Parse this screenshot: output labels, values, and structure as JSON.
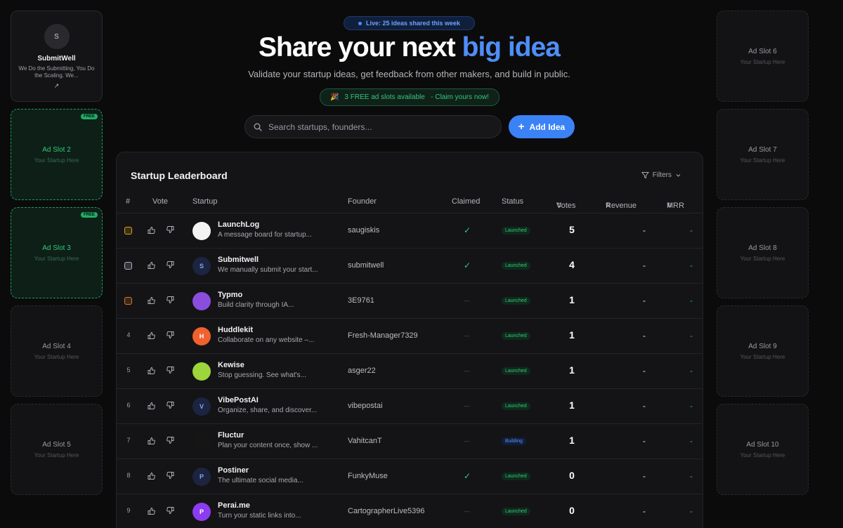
{
  "sponsor": {
    "avatar_letter": "S",
    "name": "SubmitWell",
    "tagline": "We Do the Submitting, You Do the Scaling. We...",
    "link_glyph": "↗"
  },
  "ad_slots_left": [
    {
      "title": "Ad Slot 2",
      "subtitle": "Your Startup Here",
      "badge": "FREE",
      "free": true
    },
    {
      "title": "Ad Slot 3",
      "subtitle": "Your Startup Here",
      "badge": "FREE",
      "free": true
    },
    {
      "title": "Ad Slot 4",
      "subtitle": "Your Startup Here",
      "free": false
    },
    {
      "title": "Ad Slot 5",
      "subtitle": "Your Startup Here",
      "free": false
    }
  ],
  "ad_slots_right": [
    {
      "title": "Ad Slot 6",
      "subtitle": "Your Startup Here"
    },
    {
      "title": "Ad Slot 7",
      "subtitle": "Your Startup Here"
    },
    {
      "title": "Ad Slot 8",
      "subtitle": "Your Startup Here"
    },
    {
      "title": "Ad Slot 9",
      "subtitle": "Your Startup Here"
    },
    {
      "title": "Ad Slot 10",
      "subtitle": "Your Startup Here"
    }
  ],
  "hero": {
    "live_badge": "Live: 25 ideas shared this week",
    "headline_main": "Share your next ",
    "headline_accent": "big idea",
    "subheadline": "Validate your startup ideas, get feedback from other makers, and build in public.",
    "claim_banner": "3 FREE ad slots available   - Claim yours now!",
    "claim_icon": "🎉"
  },
  "search": {
    "placeholder": "Search startups, founders..."
  },
  "add_button": {
    "label": "Add Idea",
    "icon": "+"
  },
  "leaderboard": {
    "title": "Startup Leaderboard",
    "filters_label": "Filters",
    "columns": {
      "rank": "#",
      "vote": "Vote",
      "startup": "Startup",
      "founder": "Founder",
      "claimed": "Claimed",
      "status": "Status",
      "votes": "Votes",
      "revenue": "Revenue",
      "mrr": "MRR"
    },
    "rows": [
      {
        "rank": "1",
        "medal": "#d9a21b",
        "name": "LaunchLog",
        "desc": "A message board for startup...",
        "founder": "saugiskis",
        "claimed": true,
        "status": "Launched",
        "votes": "5",
        "revenue": "-",
        "mrr": "-",
        "logo_letter": "",
        "logo_bg": "#f3f3f3"
      },
      {
        "rank": "2",
        "medal": "#a9b3c2",
        "name": "Submitwell",
        "desc": "We manually submit your start...",
        "founder": "submitwell",
        "claimed": true,
        "status": "Launched",
        "votes": "4",
        "revenue": "-",
        "mrr": "-",
        "logo_letter": "S",
        "logo_bg": "#1c2440"
      },
      {
        "rank": "3",
        "medal": "#d9772a",
        "name": "Typmo",
        "desc": "Build clarity through IA...",
        "founder": "3E9761",
        "claimed": false,
        "status": "Launched",
        "votes": "1",
        "revenue": "-",
        "mrr": "-",
        "logo_letter": "",
        "logo_bg": "#8b4dde"
      },
      {
        "rank": "4",
        "name": "Huddlekit",
        "desc": "Collaborate on any website –...",
        "founder": "Fresh-Manager7329",
        "claimed": false,
        "status": "Launched",
        "votes": "1",
        "revenue": "-",
        "mrr": "-",
        "logo_letter": "H",
        "logo_bg": "#f0612e"
      },
      {
        "rank": "5",
        "name": "Kewise",
        "desc": "Stop guessing. See what's...",
        "founder": "asger22",
        "claimed": false,
        "status": "Launched",
        "votes": "1",
        "revenue": "-",
        "mrr": "-",
        "logo_letter": "",
        "logo_bg": "#9cd63a"
      },
      {
        "rank": "6",
        "name": "VibePostAI",
        "desc": "Organize, share, and discover...",
        "founder": "vibepostai",
        "claimed": false,
        "status": "Launched",
        "votes": "1",
        "revenue": "-",
        "mrr": "-",
        "logo_letter": "V",
        "logo_bg": "#1c2440"
      },
      {
        "rank": "7",
        "name": "Fluctur",
        "desc": "Plan your content once, show ...",
        "founder": "VahitcanT",
        "claimed": false,
        "status": "Building",
        "votes": "1",
        "revenue": "-",
        "mrr": "-",
        "logo_letter": "",
        "logo_bg": "#151515"
      },
      {
        "rank": "8",
        "name": "Postiner",
        "desc": "The ultimate social media...",
        "founder": "FunkyMuse",
        "claimed": true,
        "status": "Launched",
        "votes": "0",
        "revenue": "-",
        "mrr": "-",
        "logo_letter": "P",
        "logo_bg": "#1c2440"
      },
      {
        "rank": "9",
        "name": "Perai.me",
        "desc": "Turn your static links into...",
        "founder": "CartographerLive5396",
        "claimed": false,
        "status": "Launched",
        "votes": "0",
        "revenue": "-",
        "mrr": "-",
        "logo_letter": "P",
        "logo_bg": "#8b3cf0"
      }
    ]
  },
  "colors": {
    "accent": "#4f8ef7",
    "green": "#34c77b",
    "button": "#3b82f6"
  }
}
